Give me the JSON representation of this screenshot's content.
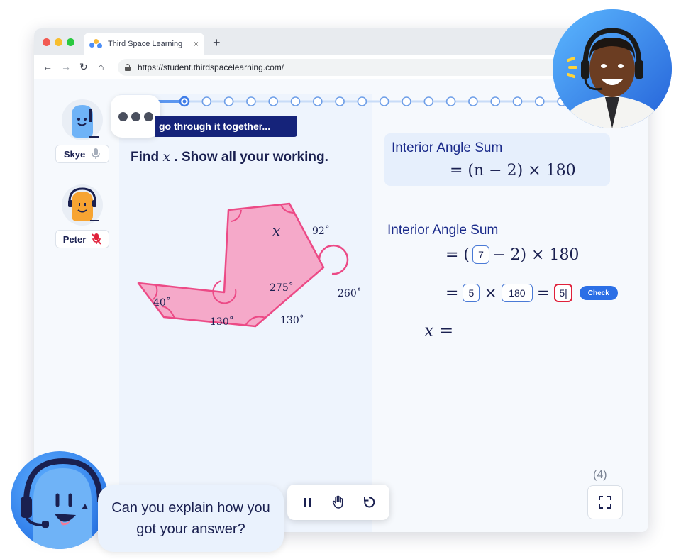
{
  "browser": {
    "tab_title": "Third Space Learning",
    "tab_close": "×",
    "new_tab": "+",
    "url": "https://student.thirdspacelearning.com/",
    "nav": {
      "back": "←",
      "forward": "→",
      "reload": "↻",
      "home": "⌂"
    }
  },
  "participants": [
    {
      "name": "Skye",
      "mic": "on"
    },
    {
      "name": "Peter",
      "mic": "muted"
    }
  ],
  "banner": "go through it together...",
  "question": {
    "prefix": "Find",
    "variable": "x",
    "suffix": ". Show all your working."
  },
  "diagram": {
    "angles": {
      "a1": "x",
      "a2": "92˚",
      "a3": "275˚",
      "a4": "40˚",
      "a5": "130˚",
      "a6": "130˚",
      "a7": "260˚"
    },
    "fill": "#f5a9c9",
    "stroke": "#ec4a86"
  },
  "working": {
    "formula_label": "Interior Angle Sum",
    "formula": "= (n − 2) × 180",
    "label": "Interior Angle Sum",
    "line1": {
      "eq": "= (",
      "box": "7",
      "rest": "− 2) × 180"
    },
    "line2": {
      "eq": "=",
      "box1": "5",
      "times": "×",
      "box2": "180",
      "eq2": "=",
      "box3": "5|",
      "check": "Check"
    },
    "line3": "x ="
  },
  "marks": "(4)",
  "chat": {
    "message": "Can you explain how you got your answer?"
  },
  "colors": {
    "brand_blue": "#2b6fe6",
    "navy": "#15237a",
    "active_red": "#e0203a"
  }
}
